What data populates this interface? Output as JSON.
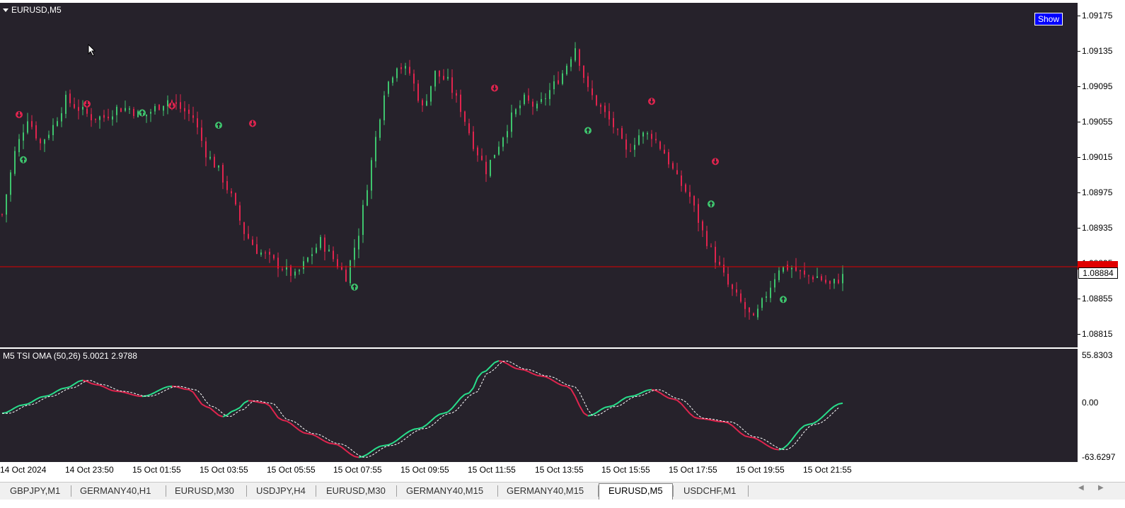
{
  "chart": {
    "symbol_label": "EURUSD,M5",
    "show_button": "Show",
    "current_price": "1.08884",
    "colors": {
      "background": "#26222b",
      "bull": "#3ec46d",
      "bear": "#e0244e",
      "price_line": "#e00000",
      "tsi_up": "#28e08c",
      "tsi_down": "#e0244e"
    },
    "price_axis": [
      "1.09175",
      "1.09135",
      "1.09095",
      "1.09055",
      "1.09015",
      "1.08975",
      "1.08935",
      "1.08895",
      "1.08855",
      "1.08815"
    ],
    "indicator": {
      "label": "M5 TSI OMA (50,26) 5.0021 2.9788",
      "axis": [
        "55.8303",
        "0.00",
        "-63.6297"
      ]
    },
    "time_axis": [
      "14 Oct 2024",
      "14 Oct 23:50",
      "15 Oct 01:55",
      "15 Oct 03:55",
      "15 Oct 05:55",
      "15 Oct 07:55",
      "15 Oct 09:55",
      "15 Oct 11:55",
      "15 Oct 13:55",
      "15 Oct 15:55",
      "15 Oct 17:55",
      "15 Oct 19:55",
      "15 Oct 21:55"
    ]
  },
  "chart_data": {
    "type": "candlestick",
    "title": "EURUSD,M5",
    "ylim": [
      1.08795,
      1.09195
    ],
    "current_price": 1.08884,
    "close_path": [
      [
        0,
        1.0895
      ],
      [
        3,
        1.0902
      ],
      [
        6,
        1.0906
      ],
      [
        9,
        1.0903
      ],
      [
        12,
        1.0905
      ],
      [
        15,
        1.0908
      ],
      [
        18,
        1.0907
      ],
      [
        21,
        1.0906
      ],
      [
        24,
        1.0906
      ],
      [
        27,
        1.0907
      ],
      [
        30,
        1.0907
      ],
      [
        33,
        1.0906
      ],
      [
        36,
        1.0907
      ],
      [
        39,
        1.0908
      ],
      [
        42,
        1.0907
      ],
      [
        45,
        1.0906
      ],
      [
        48,
        1.0902
      ],
      [
        51,
        1.09
      ],
      [
        54,
        1.0897
      ],
      [
        57,
        1.0893
      ],
      [
        60,
        1.0891
      ],
      [
        63,
        1.089
      ],
      [
        66,
        1.0889
      ],
      [
        69,
        1.0888
      ],
      [
        72,
        1.089
      ],
      [
        75,
        1.0892
      ],
      [
        78,
        1.089
      ],
      [
        81,
        1.0888
      ],
      [
        84,
        1.0893
      ],
      [
        87,
        1.0901
      ],
      [
        90,
        1.0909
      ],
      [
        93,
        1.0912
      ],
      [
        96,
        1.0911
      ],
      [
        99,
        1.0907
      ],
      [
        102,
        1.0911
      ],
      [
        105,
        1.091
      ],
      [
        108,
        1.0907
      ],
      [
        111,
        1.0903
      ],
      [
        114,
        1.09
      ],
      [
        117,
        1.0903
      ],
      [
        120,
        1.0906
      ],
      [
        123,
        1.0908
      ],
      [
        126,
        1.0907
      ],
      [
        129,
        1.0909
      ],
      [
        132,
        1.0911
      ],
      [
        135,
        1.0914
      ],
      [
        138,
        1.0909
      ],
      [
        141,
        1.0907
      ],
      [
        144,
        1.0905
      ],
      [
        147,
        1.0902
      ],
      [
        150,
        1.0904
      ],
      [
        153,
        1.0904
      ],
      [
        156,
        1.0902
      ],
      [
        159,
        1.0899
      ],
      [
        162,
        1.0897
      ],
      [
        165,
        1.0893
      ],
      [
        168,
        1.089
      ],
      [
        171,
        1.0887
      ],
      [
        174,
        1.0885
      ],
      [
        177,
        1.0883
      ],
      [
        180,
        1.0886
      ],
      [
        183,
        1.0889
      ],
      [
        186,
        1.0889
      ],
      [
        189,
        1.0888
      ],
      [
        192,
        1.0888
      ],
      [
        195,
        1.0887
      ],
      [
        198,
        1.0888
      ]
    ],
    "signals": [
      {
        "bar": 4,
        "type": "sell",
        "price": 1.09063
      },
      {
        "bar": 5,
        "type": "buy",
        "price": 1.09012
      },
      {
        "bar": 20,
        "type": "sell",
        "price": 1.09075
      },
      {
        "bar": 33,
        "type": "buy",
        "price": 1.09065
      },
      {
        "bar": 40,
        "type": "sell",
        "price": 1.09073
      },
      {
        "bar": 51,
        "type": "buy",
        "price": 1.09051
      },
      {
        "bar": 59,
        "type": "sell",
        "price": 1.09053
      },
      {
        "bar": 83,
        "type": "buy",
        "price": 1.08868
      },
      {
        "bar": 116,
        "type": "sell",
        "price": 1.09093
      },
      {
        "bar": 138,
        "type": "buy",
        "price": 1.09045
      },
      {
        "bar": 153,
        "type": "sell",
        "price": 1.09078
      },
      {
        "bar": 167,
        "type": "buy",
        "price": 1.08962
      },
      {
        "bar": 168,
        "type": "sell",
        "price": 1.0901
      },
      {
        "bar": 184,
        "type": "buy",
        "price": 1.08854
      }
    ],
    "indicator": {
      "name": "M5 TSI OMA (50,26)",
      "ylim": [
        -63.6297,
        55.8303
      ],
      "tsi": [
        [
          0,
          -12
        ],
        [
          5,
          -2
        ],
        [
          10,
          8
        ],
        [
          15,
          18
        ],
        [
          19,
          27
        ],
        [
          22,
          22
        ],
        [
          27,
          14
        ],
        [
          33,
          8
        ],
        [
          40,
          20
        ],
        [
          44,
          16
        ],
        [
          48,
          -4
        ],
        [
          52,
          -16
        ],
        [
          55,
          -8
        ],
        [
          58,
          3
        ],
        [
          62,
          0
        ],
        [
          66,
          -20
        ],
        [
          72,
          -36
        ],
        [
          78,
          -48
        ],
        [
          84,
          -64
        ],
        [
          90,
          -50
        ],
        [
          98,
          -30
        ],
        [
          104,
          -12
        ],
        [
          110,
          12
        ],
        [
          113,
          36
        ],
        [
          117,
          50
        ],
        [
          122,
          40
        ],
        [
          127,
          32
        ],
        [
          133,
          20
        ],
        [
          138,
          -15
        ],
        [
          143,
          -4
        ],
        [
          148,
          8
        ],
        [
          153,
          16
        ],
        [
          158,
          5
        ],
        [
          164,
          -18
        ],
        [
          170,
          -22
        ],
        [
          176,
          -40
        ],
        [
          183,
          -55
        ],
        [
          190,
          -25
        ],
        [
          198,
          0
        ]
      ]
    }
  }
}
